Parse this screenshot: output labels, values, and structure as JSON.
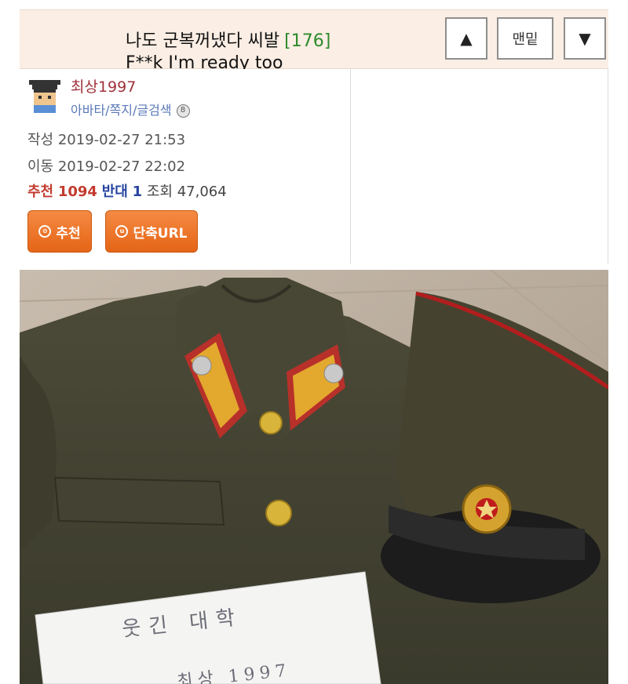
{
  "post": {
    "title": "나도 군복꺼냈다 씨발",
    "comment_count": "[176]",
    "caption": "F**k I'm ready too"
  },
  "nav": {
    "up_label": "▲",
    "bottom_label": "맨밑",
    "down_label": "▼"
  },
  "author": {
    "name": "최상1997",
    "links": "아바타/쪽지/글검색",
    "badge": "8"
  },
  "meta": {
    "written_label": "작성",
    "written": "2019-02-27 21:53",
    "moved_label": "이동",
    "moved": "2019-02-27 22:02",
    "recommend_label": "추천",
    "recommend": "1094",
    "oppose_label": "반대",
    "oppose": "1",
    "views_label": "조회",
    "views": "47,064"
  },
  "actions": {
    "recommend_button": "추천",
    "shorturl_button": "단축URL",
    "recommend_icon_glyph": "⊙",
    "shorturl_icon_glyph": "u"
  },
  "photo": {
    "paper_line1": "웃긴 대학",
    "paper_line2": "최상 1997"
  },
  "colors": {
    "header_bg": "#fbeee4",
    "author": "#a0313a",
    "links": "#5a78b8",
    "count": "#2c8a2c",
    "button": "#ee7427"
  }
}
